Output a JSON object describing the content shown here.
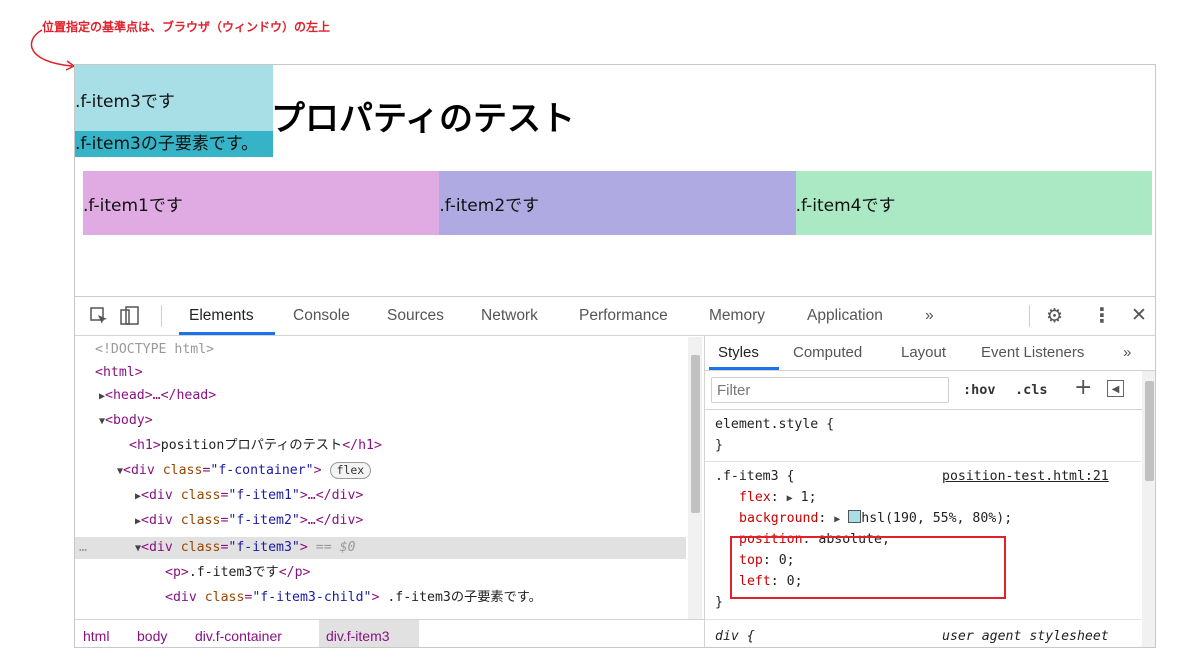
{
  "annotation": {
    "text": "位置指定の基準点は、ブラウザ（ウィンドウ）の左上",
    "color": "#e0202a"
  },
  "page": {
    "title": "positionプロパティのテスト",
    "title_visible": "プロパティのテスト",
    "items": {
      "item1": ".f-item1です",
      "item2": ".f-item2です",
      "item3": ".f-item3です",
      "item3_child": ".f-item3の子要素です。",
      "item4": ".f-item4です"
    },
    "colors": {
      "item1": "#e0aae2",
      "item2": "#afaae2",
      "item3": "#a8dfe7",
      "item3_child": "#36b3c7",
      "item4": "#aae9c4"
    }
  },
  "devtools": {
    "icons": [
      "inspect-icon",
      "device-toolbar-icon",
      "gear-icon",
      "kebab-menu-icon",
      "close-icon"
    ],
    "tabs": {
      "elements": "Elements",
      "console": "Console",
      "sources": "Sources",
      "network": "Network",
      "performance": "Performance",
      "memory": "Memory",
      "application": "Application",
      "more": "»"
    },
    "dom": {
      "doctype": "<!DOCTYPE html>",
      "html": "<html>",
      "head": "<head>…</head>",
      "body": "<body>",
      "h1_open": "<h1>",
      "h1_text": "positionプロパティのテスト",
      "h1_close": "</h1>",
      "container_open": "<div ",
      "attr_class": "class",
      "eq": "=",
      "container_class": "\"f-container\"",
      "gt": ">",
      "flex_badge": "flex",
      "item1_class": "\"f-item1\"",
      "item2_class": "\"f-item2\"",
      "item3_class": "\"f-item3\"",
      "collapsed_close": ">…</div>",
      "selected_marker": " == $0",
      "ellipsis": "…",
      "p_open": "<p>",
      "p_text": ".f-item3です",
      "p_close": "</p>",
      "child_class": "\"f-item3-child\"",
      "child_text": " .f-item3の子要素です。"
    },
    "breadcrumbs": [
      "html",
      "body",
      "div.f-container",
      "div.f-item3"
    ],
    "styles": {
      "tabs": {
        "styles": "Styles",
        "computed": "Computed",
        "layout": "Layout",
        "event_listeners": "Event Listeners",
        "more": "»"
      },
      "filter_placeholder": "Filter",
      "hov": ":hov",
      "cls": ".cls",
      "plus": "+",
      "element_style": "element.style {",
      "close_brace": "}",
      "rule_selector": ".f-item3 {",
      "rule_source": "position-test.html:21",
      "decls": [
        {
          "prop": "flex",
          "value": " 1;",
          "expandable": true
        },
        {
          "prop": "background",
          "value": "hsl(190, 55%, 80%);",
          "expandable": true,
          "swatch": "#a8dfe7"
        },
        {
          "prop": "position",
          "value": " absolute;"
        },
        {
          "prop": "top",
          "value": " 0;"
        },
        {
          "prop": "left",
          "value": " 0;"
        }
      ],
      "next_selector": "div {",
      "next_source": "user agent stylesheet"
    }
  }
}
